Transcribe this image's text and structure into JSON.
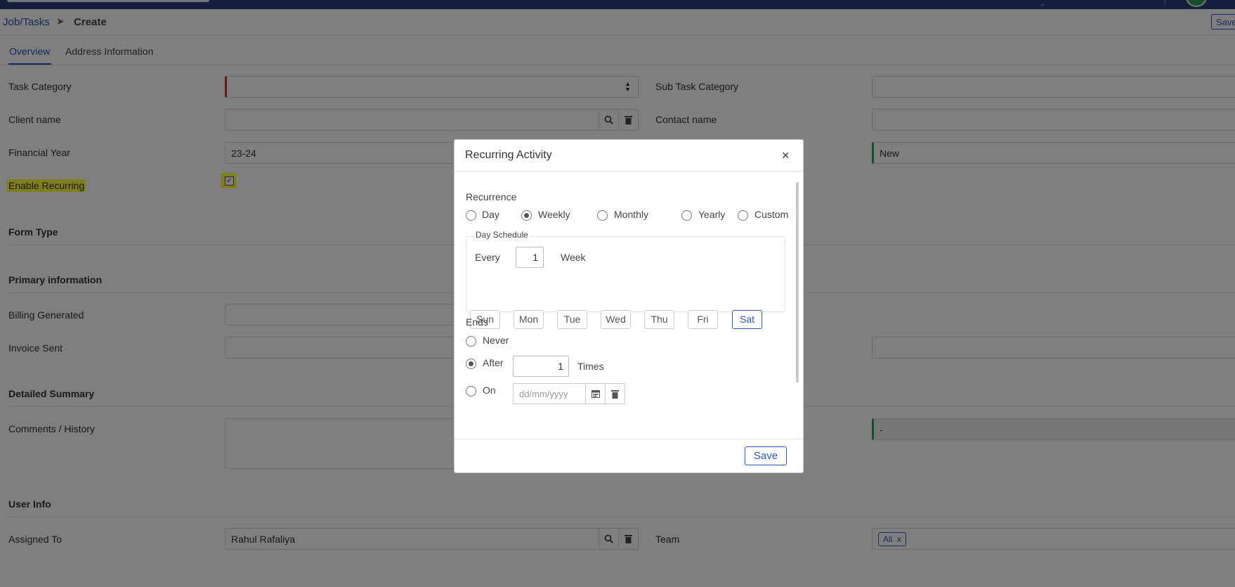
{
  "breadcrumb": {
    "parent": "Job/Tasks",
    "current": "Create",
    "separator": "➤"
  },
  "header": {
    "save_label": "Save"
  },
  "tabs": [
    {
      "label": "Overview",
      "active": true
    },
    {
      "label": "Address Information",
      "active": false
    }
  ],
  "form": {
    "task_category": {
      "label": "Task Category",
      "value": ""
    },
    "sub_task_category": {
      "label": "Sub Task Category",
      "value": ""
    },
    "client_name": {
      "label": "Client name",
      "value": ""
    },
    "contact_name": {
      "label": "Contact name",
      "value": ""
    },
    "financial_year": {
      "label": "Financial Year",
      "value": "23-24"
    },
    "status_value": "New",
    "enable_recurring": {
      "label": "Enable Recurring",
      "checked": true
    },
    "form_type_heading": "Form Type",
    "primary_info_heading": "Primary information",
    "billing_generated": {
      "label": "Billing Generated"
    },
    "invoice_sent": {
      "label": "Invoice Sent"
    },
    "detailed_summary_heading": "Detailed Summary",
    "comments": {
      "label": "Comments / History"
    },
    "summary_value": "-",
    "user_info_heading": "User Info",
    "assigned_to": {
      "label": "Assigned To",
      "value": "Rahul Rafaliya"
    },
    "team": {
      "label": "Team",
      "tag": "All",
      "tag_remove": "x"
    }
  },
  "modal": {
    "title": "Recurring Activity",
    "close": "×",
    "recurrence_label": "Recurrence",
    "recurrence_options": [
      "Day",
      "Weekly",
      "Monthly",
      "Yearly",
      "Custom"
    ],
    "recurrence_selected": "Weekly",
    "day_schedule_legend": "Day Schedule",
    "every_label": "Every",
    "every_value": "1",
    "unit_label": "Week",
    "days": [
      "Sun",
      "Mon",
      "Tue",
      "Wed",
      "Thu",
      "Fri",
      "Sat"
    ],
    "selected_day": "Sat",
    "ends_label": "Ends",
    "ends_options": {
      "never": "Never",
      "after": "After",
      "on": "On"
    },
    "ends_selected": "After",
    "after_value": "1",
    "times_label": "Times",
    "date_placeholder": "dd/mm/yyyy",
    "save_label": "Save"
  },
  "colors": {
    "topbar": "#2c3e7b",
    "accent": "#2d56b8",
    "required": "#d32f2f",
    "highlight": "#ffff40",
    "success": "#2e9e5a"
  }
}
